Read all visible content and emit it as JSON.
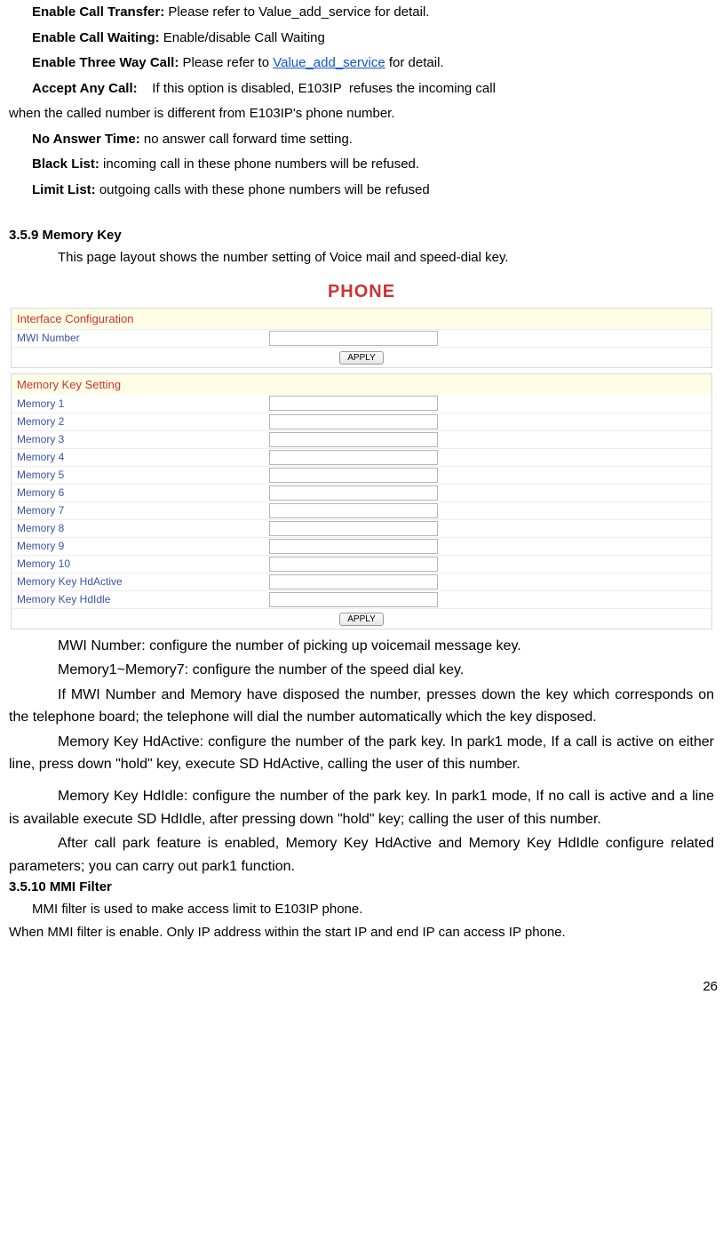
{
  "defs": {
    "transfer": {
      "label": "Enable Call Transfer:",
      "text": " Please refer to Value_add_service for detail."
    },
    "waiting": {
      "label": "Enable Call Waiting:",
      "text": " Enable/disable Call Waiting"
    },
    "threeway": {
      "label": "Enable Three Way Call:",
      "pre": " Please refer to ",
      "link": "Value_add_service",
      "post": " for detail."
    },
    "accept": {
      "label": "Accept Any Call:",
      "lead": "    If this option is disabled, E103IP  refuses the incoming call",
      "cont": "when the called number is different from E103IP's  phone number."
    },
    "noanswer": {
      "label": "No Answer Time:",
      "text": " no answer call forward time setting."
    },
    "blacklist": {
      "label": "Black List:",
      "text": "  incoming call in these phone numbers will be refused."
    },
    "limitlist": {
      "label": "Limit List:",
      "text": "  outgoing calls with these phone numbers will be refused"
    }
  },
  "section_memory": {
    "heading": "3.5.9 Memory Key",
    "intro": "This page layout shows the number setting of Voice mail and speed-dial key."
  },
  "phone_title": "PHONE",
  "panel1": {
    "header": "Interface Configuration",
    "row_label": "MWI Number",
    "row_value": "",
    "apply": "APPLY"
  },
  "panel2": {
    "header": "Memory Key Setting",
    "rows": [
      {
        "label": "Memory 1",
        "value": ""
      },
      {
        "label": "Memory 2",
        "value": ""
      },
      {
        "label": "Memory 3",
        "value": ""
      },
      {
        "label": "Memory 4",
        "value": ""
      },
      {
        "label": "Memory 5",
        "value": ""
      },
      {
        "label": "Memory 6",
        "value": ""
      },
      {
        "label": "Memory 7",
        "value": ""
      },
      {
        "label": "Memory 8",
        "value": ""
      },
      {
        "label": "Memory 9",
        "value": ""
      },
      {
        "label": "Memory 10",
        "value": ""
      },
      {
        "label": "Memory Key HdActive",
        "value": ""
      },
      {
        "label": "Memory Key HdIdle",
        "value": ""
      }
    ],
    "apply": "APPLY"
  },
  "desc": {
    "p1": "MWI Number: configure the number of picking up voicemail message key.",
    "p2": "Memory1~Memory7: configure the number of the speed dial key.",
    "p3": "If MWI Number and Memory have disposed the number, presses down the key which corresponds on the telephone board; the telephone will dial the number automatically which the key disposed.",
    "p4": "Memory Key HdActive: configure the number of the park key. In park1 mode, If a call is active on either line, press down \"hold\" key, execute SD HdActive, calling the user of this number.",
    "p5": "Memory Key HdIdle: configure the number of the park key. In park1 mode, If no call is active and a line is available execute SD HdIdle, after pressing down \"hold\" key; calling the user of this number.",
    "p6": "After call park feature is enabled, Memory Key HdActive and Memory Key HdIdle configure related parameters; you can carry out park1 function."
  },
  "section_mmi": {
    "heading": "3.5.10 MMI Filter",
    "line1": "MMI filter is used to make access limit to E103IP  phone.",
    "line2": "When MMI filter is enable. Only IP address within the start IP and end IP can access IP phone."
  },
  "page_number": "26"
}
